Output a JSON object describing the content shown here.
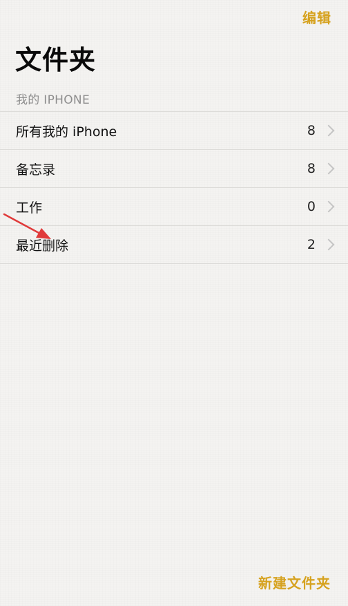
{
  "header": {
    "edit_label": "编辑",
    "title": "文件夹"
  },
  "section": {
    "label": "我的 IPHONE"
  },
  "folders": [
    {
      "name": "所有我的 iPhone",
      "count": "8"
    },
    {
      "name": "备忘录",
      "count": "8"
    },
    {
      "name": "工作",
      "count": "0"
    },
    {
      "name": "最近删除",
      "count": "2"
    }
  ],
  "footer": {
    "new_folder_label": "新建文件夹"
  },
  "colors": {
    "accent": "#d6a21f",
    "background": "#f4f3f1",
    "annotation_arrow": "#e03a3a"
  },
  "icons": {
    "row_disclosure": "chevron-right-icon"
  }
}
